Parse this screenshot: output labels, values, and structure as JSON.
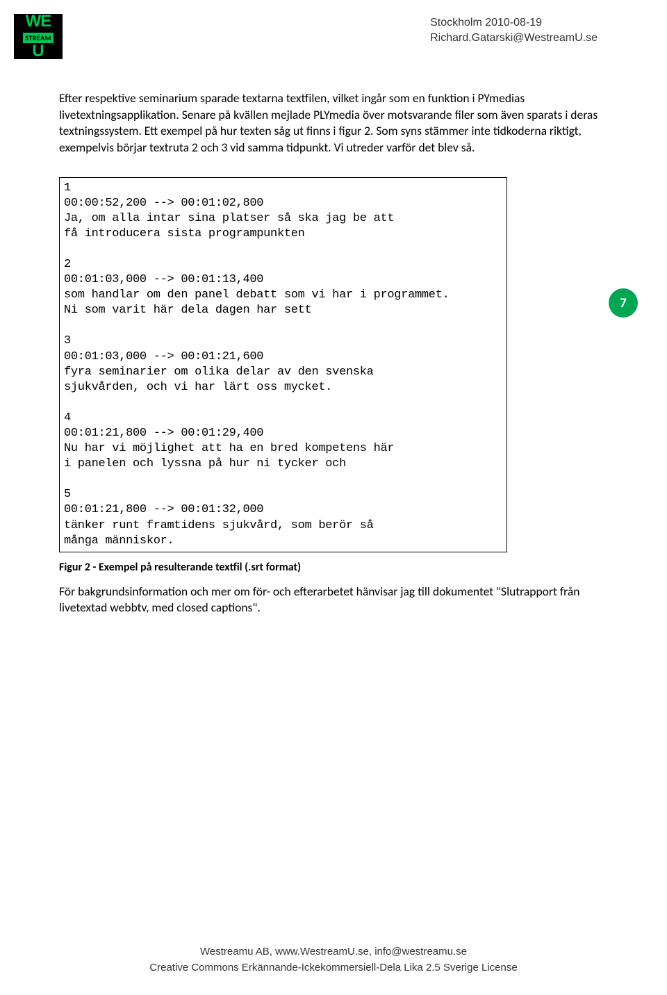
{
  "header": {
    "date_location": "Stockholm 2010-08-19",
    "email": "Richard.Gatarski@WestreamU.se"
  },
  "logo": {
    "we": "WE",
    "stream": "STREAM",
    "u": "U"
  },
  "body": {
    "p1": "Efter respektive seminarium sparade textarna textfilen, vilket ingår som en funktion i PYmedias livetextningsapplikation. Senare på kvällen mejlade PLYmedia över motsvarande filer som även sparats i deras textningssystem. Ett exempel på hur texten såg ut finns i figur 2. Som syns stämmer inte tidkoderna riktigt, exempelvis börjar textruta 2 och 3 vid samma tidpunkt. Vi utreder varför det blev så.",
    "code": "1\n00:00:52,200 --> 00:01:02,800\nJa, om alla intar sina platser så ska jag be att\nfå introducera sista programpunkten\n\n2\n00:01:03,000 --> 00:01:13,400\nsom handlar om den panel debatt som vi har i programmet.\nNi som varit här dela dagen har sett\n\n3\n00:01:03,000 --> 00:01:21,600\nfyra seminarier om olika delar av den svenska\nsjukvården, och vi har lärt oss mycket.\n\n4\n00:01:21,800 --> 00:01:29,400\nNu har vi möjlighet att ha en bred kompetens här\ni panelen och lyssna på hur ni tycker och\n\n5\n00:01:21,800 --> 00:01:32,000\ntänker runt framtidens sjukvård, som berör så\nmånga människor.",
    "caption": "Figur 2 - Exempel på resulterande textfil (.srt format)",
    "p2": "För bakgrundsinformation och mer om för- och efterarbetet hänvisar jag till dokumentet \"Slutrapport från livetextad webbtv, med closed captions\"."
  },
  "page_number": "7",
  "footer": {
    "line1": "Westreamu AB, www.WestreamU.se, info@westreamu.se",
    "line2": "Creative Commons Erkännande-Ickekommersiell-Dela Lika 2.5 Sverige License"
  }
}
